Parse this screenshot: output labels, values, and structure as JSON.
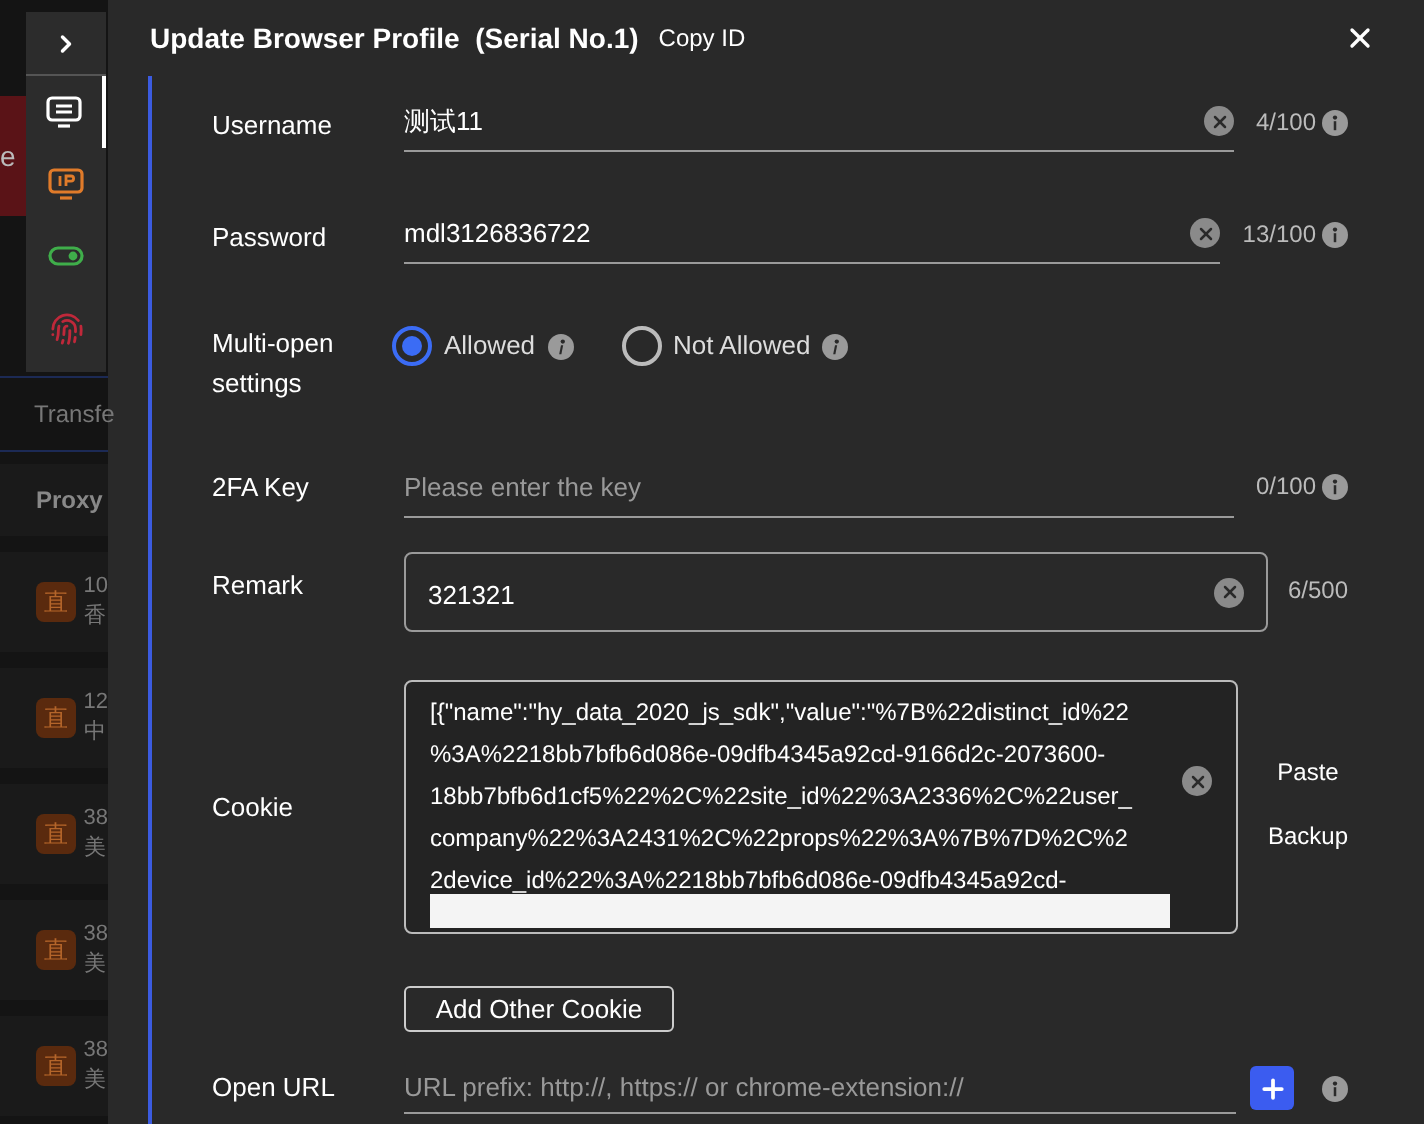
{
  "background_app": {
    "button": "e",
    "tab": "Transfe",
    "column": "Proxy",
    "rows": [
      {
        "badge": "直",
        "line1": "10",
        "line2": "香"
      },
      {
        "badge": "直",
        "line1": "12",
        "line2": "中"
      },
      {
        "badge": "直",
        "line1": "38",
        "line2": "美"
      },
      {
        "badge": "直",
        "line1": "38",
        "line2": "美"
      },
      {
        "badge": "直",
        "line1": "38",
        "line2": "美"
      }
    ]
  },
  "side_toolbar": {
    "items": [
      {
        "kind": "profile",
        "selected": true
      },
      {
        "kind": "ip",
        "selected": false
      },
      {
        "kind": "toggle",
        "selected": false
      },
      {
        "kind": "fingerprint",
        "selected": false
      }
    ]
  },
  "dialog": {
    "title": "Update Browser Profile  (Serial No.1)",
    "copy_link": "Copy ID",
    "username": {
      "label": "Username",
      "value": "测试11",
      "count": "4/100"
    },
    "password": {
      "label": "Password",
      "value": "mdl3126836722",
      "count": "13/100"
    },
    "multi_open": {
      "label": "Multi-open settings",
      "options": [
        {
          "label": "Allowed",
          "selected": true
        },
        {
          "label": "Not Allowed",
          "selected": false
        }
      ]
    },
    "twofa": {
      "label": "2FA Key",
      "placeholder": "Please enter the key",
      "count": "0/100"
    },
    "remark": {
      "label": "Remark",
      "value": "321321",
      "count": "6/500"
    },
    "cookie": {
      "label": "Cookie",
      "value_lines": [
        "[{\"name\":\"hy_data_2020_js_sdk\",\"value\":\"%7B%22distinct_id%22",
        "%3A%2218bb7bfb6d086e-09dfb4345a92cd-9166d2c-2073600-",
        "18bb7bfb6d1cf5%22%2C%22site_id%22%3A2336%2C%22user_",
        "company%22%3A2431%2C%22props%22%3A%7B%7D%2C%2",
        "2device_id%22%3A%2218bb7bfb6d086e-09dfb4345a92cd-"
      ],
      "actions": [
        "Paste",
        "Backup"
      ],
      "add_button": "Add Other Cookie"
    },
    "open_url": {
      "label": "Open URL",
      "placeholder": "URL prefix: http://, https:// or chrome-extension://"
    }
  }
}
